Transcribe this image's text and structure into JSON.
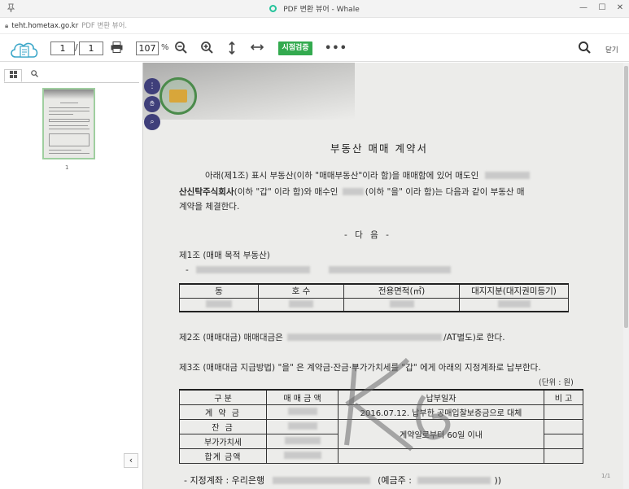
{
  "window": {
    "title": "PDF 변환 뷰어 - Whale",
    "pin_icon": "pin-icon",
    "minimize_icon": "minimize-icon",
    "maximize_icon": "maximize-icon",
    "close_icon": "close-icon"
  },
  "address": {
    "host": "teht.hometax.go.kr",
    "page_title": "PDF 변환 뷰어."
  },
  "toolbar": {
    "current_page": "1",
    "total_pages": "1",
    "zoom": "107",
    "zoom_unit": "%",
    "verify_label": "시점검증",
    "close_label": "닫기",
    "accent": "#33aa4f"
  },
  "sidebar": {
    "thumbnail_label": "1"
  },
  "document": {
    "title": "부동산 매매 계약서",
    "intro_1a": "아래(제1조) 표시 부동산(이하 \"매매부동산\"이라 함)을 매매함에 있어 매도인",
    "intro_2a": "산신탁주식회사",
    "intro_2b": "(이하 \"갑\" 이라 함)와 매수인",
    "intro_2c": "(이하 \"을\" 이라 함)는 다음과 같이 부동산 매",
    "intro_3": "계약을 체결한다.",
    "center": "- 다        음 -",
    "art1": "제1조 (매매 목적 부동산)",
    "art1_dash": "-",
    "t1_headers": [
      "동",
      "호 수",
      "전용면적(㎡)",
      "대지지분(대지권미등기)"
    ],
    "art2a": "제2조 (매매대금) 매매대금은",
    "art2b": "/AT별도)로 한다.",
    "art3": "제3조 (매매대금 지급방법) \"을\" 은 계약금·잔금·부가가치세를 \"갑\" 에게 아래의 지정계좌로 납부한다.",
    "unit": "(단위 : 원)",
    "t2_headers": [
      "구    분",
      "매 매 금 액",
      "납부일자",
      "비  고"
    ],
    "t2_rows": [
      "계 약 금",
      "잔    금",
      "부가가치세",
      "합계 금액"
    ],
    "t2_date1": "2016.07.12. 납부한 공매입찰보증금으로 대체",
    "t2_date2": "계약일로부터 60일 이내",
    "account_a": "- 지정계좌 : 우리은행",
    "account_b": "(예금주 :",
    "account_c": "))",
    "page_indicator": "1/1"
  }
}
